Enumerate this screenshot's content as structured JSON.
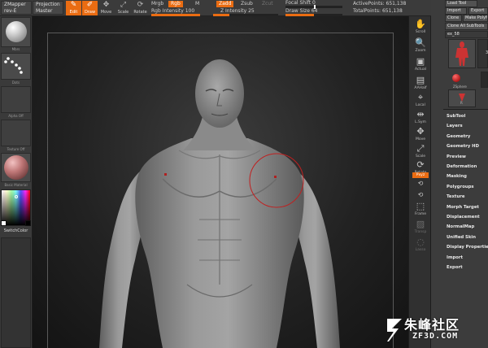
{
  "topbar": {
    "zmapper": "ZMapper",
    "rev": "rev-E",
    "projection": "Projection",
    "master": "Master",
    "edit": "Edit",
    "draw": "Draw",
    "move": "Move",
    "scale": "Scale",
    "rotate": "Rotate",
    "mrgb": "Mrgb",
    "rgb": "Rgb",
    "m": "M",
    "rgb_intensity_label": "Rgb Intensity",
    "rgb_intensity_value": "100",
    "zadd": "Zadd",
    "zsub": "Zsub",
    "zcut": "Zcut",
    "z_intensity_label": "Z Intensity",
    "z_intensity_value": "25",
    "focal_shift_label": "Focal Shift",
    "focal_shift_value": "0",
    "draw_size_label": "Draw Size",
    "draw_size_value": "64",
    "active_points_label": "ActivePoints:",
    "active_points_value": "651,138",
    "total_points_label": "TotalPoints:",
    "total_points_value": "651,138",
    "rgb_intensity_fraction": 1.0,
    "z_intensity_fraction": 0.25,
    "focal_shift_fraction": 0.5,
    "draw_size_fraction": 0.5
  },
  "leftbar": {
    "material_label": "Mbrs",
    "stroke_label": "Dots",
    "alpha_label": "Alpha Off",
    "texture_label": "Texture Off",
    "matcap_label": "Basic Material",
    "switch_color": "SwitchColor"
  },
  "rightshelf": {
    "scroll": "Scroll",
    "zoom": "Zoom",
    "actual": "Actual",
    "aahalf": "AAHalf",
    "local": "Local",
    "lsym": "L.Sym",
    "move": "Move",
    "scale": "Scale",
    "rotate": "Rotate",
    "xyz": "Pxyz",
    "frame": "Frame",
    "transp": "Transp",
    "lasso": "Lasso"
  },
  "palette": {
    "load_tool": "Load Tool",
    "import": "Import",
    "export": "Export",
    "clone": "Clone",
    "make_polymesh": "Make PolyMesh3D",
    "clone_all": "Clone All SubTools",
    "tool_name": "ex_58",
    "zsphere": "ZSphere",
    "polymesh": "PolyMesh",
    "extra": "3",
    "r": "R"
  },
  "menu": [
    "SubTool",
    "Layers",
    "Geometry",
    "Geometry HD",
    "Preview",
    "Deformation",
    "Masking",
    "Polygroups",
    "Texture",
    "Morph Target",
    "Displacement",
    "NormalMap",
    "Unified Skin",
    "Display Properties",
    "Import",
    "Export"
  ],
  "watermark": {
    "name": "朱峰社区",
    "site": "ZF3D.COM"
  },
  "colors": {
    "accent": "#ea6c12",
    "brush_ring": "#c02020",
    "bg": "#2a2a2a"
  }
}
